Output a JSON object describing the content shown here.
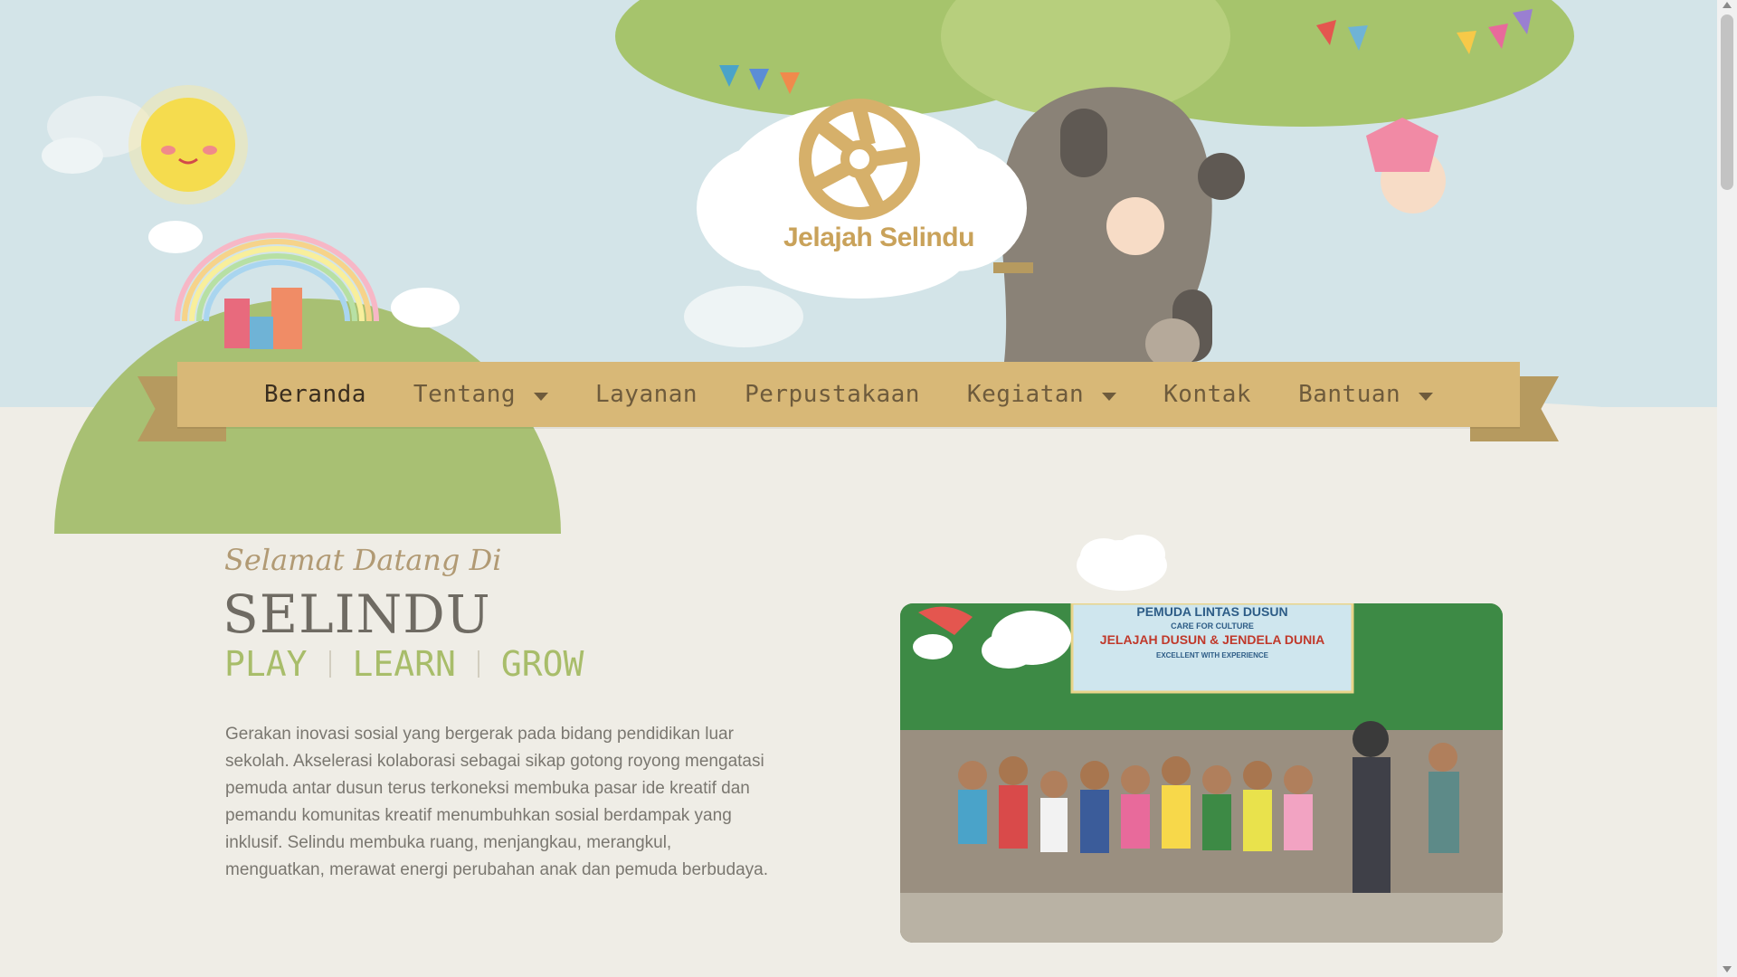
{
  "site": {
    "logo_text": "Jelajah Selindu"
  },
  "nav": {
    "items": [
      {
        "label": "Beranda",
        "active": true,
        "dropdown": false
      },
      {
        "label": "Tentang",
        "dropdown": true
      },
      {
        "label": "Layanan",
        "dropdown": false
      },
      {
        "label": "Perpustakaan",
        "dropdown": false
      },
      {
        "label": "Kegiatan",
        "dropdown": true
      },
      {
        "label": "Kontak",
        "dropdown": false
      },
      {
        "label": "Bantuan",
        "dropdown": true
      }
    ]
  },
  "hero": {
    "welcome": "Selamat Datang Di",
    "brand": "SELINDU",
    "tagline": [
      "PLAY",
      "LEARN",
      "GROW"
    ],
    "description": "Gerakan inovasi sosial yang bergerak pada bidang pendidikan luar sekolah. Akselerasi kolaborasi sebagai sikap gotong royong mengatasi pemuda antar dusun terus terkoneksi membuka pasar ide kreatif dan pemandu komunitas kreatif  menumbuhkan sosial berdampak yang inklusif. Selindu membuka ruang, menjangkau, merangkul, menguatkan, merawat energi perubahan anak dan pemuda berbudaya."
  },
  "photo_banner": {
    "line1": "PEMUDA LINTAS DUSUN",
    "line2": "CARE FOR CULTURE",
    "line3": "JELAJAH DUSUN & JENDELA DUNIA",
    "line4": "EXCELLENT WITH EXPERIENCE"
  },
  "colors": {
    "sky": "#d3e4e8",
    "ground": "#efede6",
    "nav_bg": "#d8b877",
    "tagline": "#a8bd6a",
    "brand": "#6f6b63"
  }
}
